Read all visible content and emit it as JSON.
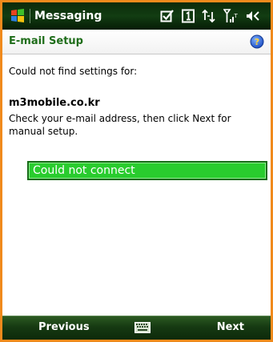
{
  "titlebar": {
    "app_title": "Messaging",
    "icons": [
      "windows-logo-icon",
      "task-checkbox-icon",
      "sim-slot-icon",
      "data-arrows-icon",
      "signal-strength-icon",
      "speaker-icon"
    ]
  },
  "header": {
    "title": "E-mail Setup",
    "help_icon": "help-icon"
  },
  "content": {
    "message": "Could not find settings for:",
    "domain": "m3mobile.co.kr",
    "instructions": "Check your e-mail address, then click Next for manual setup.",
    "status": "Could not connect"
  },
  "softkeys": {
    "left": "Previous",
    "center_icon": "keyboard-icon",
    "right": "Next"
  },
  "colors": {
    "frame_border": "#f08a1c",
    "header_text": "#1f6d1a",
    "status_fill": "#29cc2e",
    "bar_green": "#163a12"
  }
}
